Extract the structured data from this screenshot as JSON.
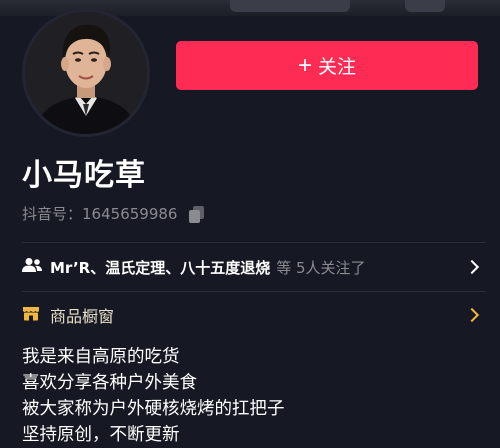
{
  "profile": {
    "follow_label": "关注",
    "name": "小马吃草",
    "id_label": "抖音号：",
    "id_value": "1645659986"
  },
  "followers_row": {
    "names": "Mr’R、温氏定理、八十五度退烧",
    "suffix": "等 5人关注了"
  },
  "shop_row": {
    "label": "商品橱窗"
  },
  "bio": {
    "lines": [
      "我是来自高原的吃货",
      "喜欢分享各种户外美食",
      "被大家称为户外硬核烧烤的扛把子",
      "坚持原创，不断更新"
    ]
  },
  "colors": {
    "background": "#161823",
    "follow_button": "#fe2c55",
    "shop_icon": "#f1b83e"
  },
  "icons": {
    "follow": "plus-icon",
    "copy": "copy-icon",
    "followers": "people-icon",
    "shop": "shop-icon",
    "more": "chevron-right-icon"
  }
}
